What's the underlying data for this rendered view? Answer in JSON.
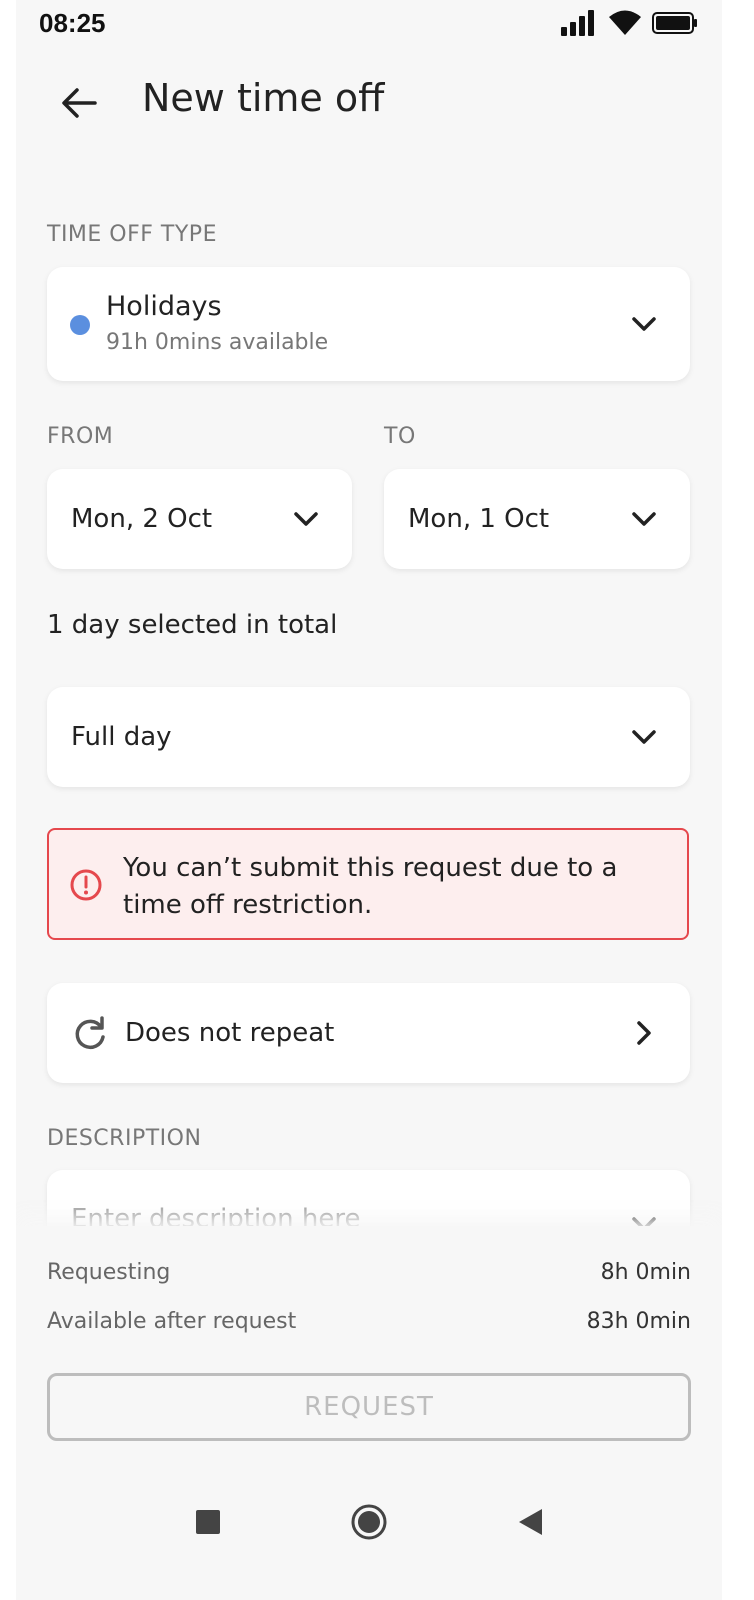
{
  "status_bar": {
    "time": "08:25"
  },
  "header": {
    "title": "New time off"
  },
  "time_off_type": {
    "label": "TIME OFF TYPE",
    "name": "Holidays",
    "available": "91h 0mins available",
    "dot_color": "#5b8fdf"
  },
  "dates": {
    "from_label": "FROM",
    "from_value": "Mon, 2 Oct",
    "to_label": "TO",
    "to_value": "Mon, 1 Oct"
  },
  "total": "1 day selected in total",
  "duration": {
    "value": "Full day"
  },
  "alert": {
    "text": "You can’t submit this request due to a time off restriction.",
    "color": "#e5484d"
  },
  "repeat": {
    "label": "Does not repeat"
  },
  "description": {
    "label": "DESCRIPTION",
    "placeholder": "Enter description here"
  },
  "summary": {
    "requesting_label": "Requesting",
    "requesting_value": "8h 0min",
    "available_label": "Available after request",
    "available_value": "83h 0min"
  },
  "request_button": {
    "label": "REQUEST"
  }
}
